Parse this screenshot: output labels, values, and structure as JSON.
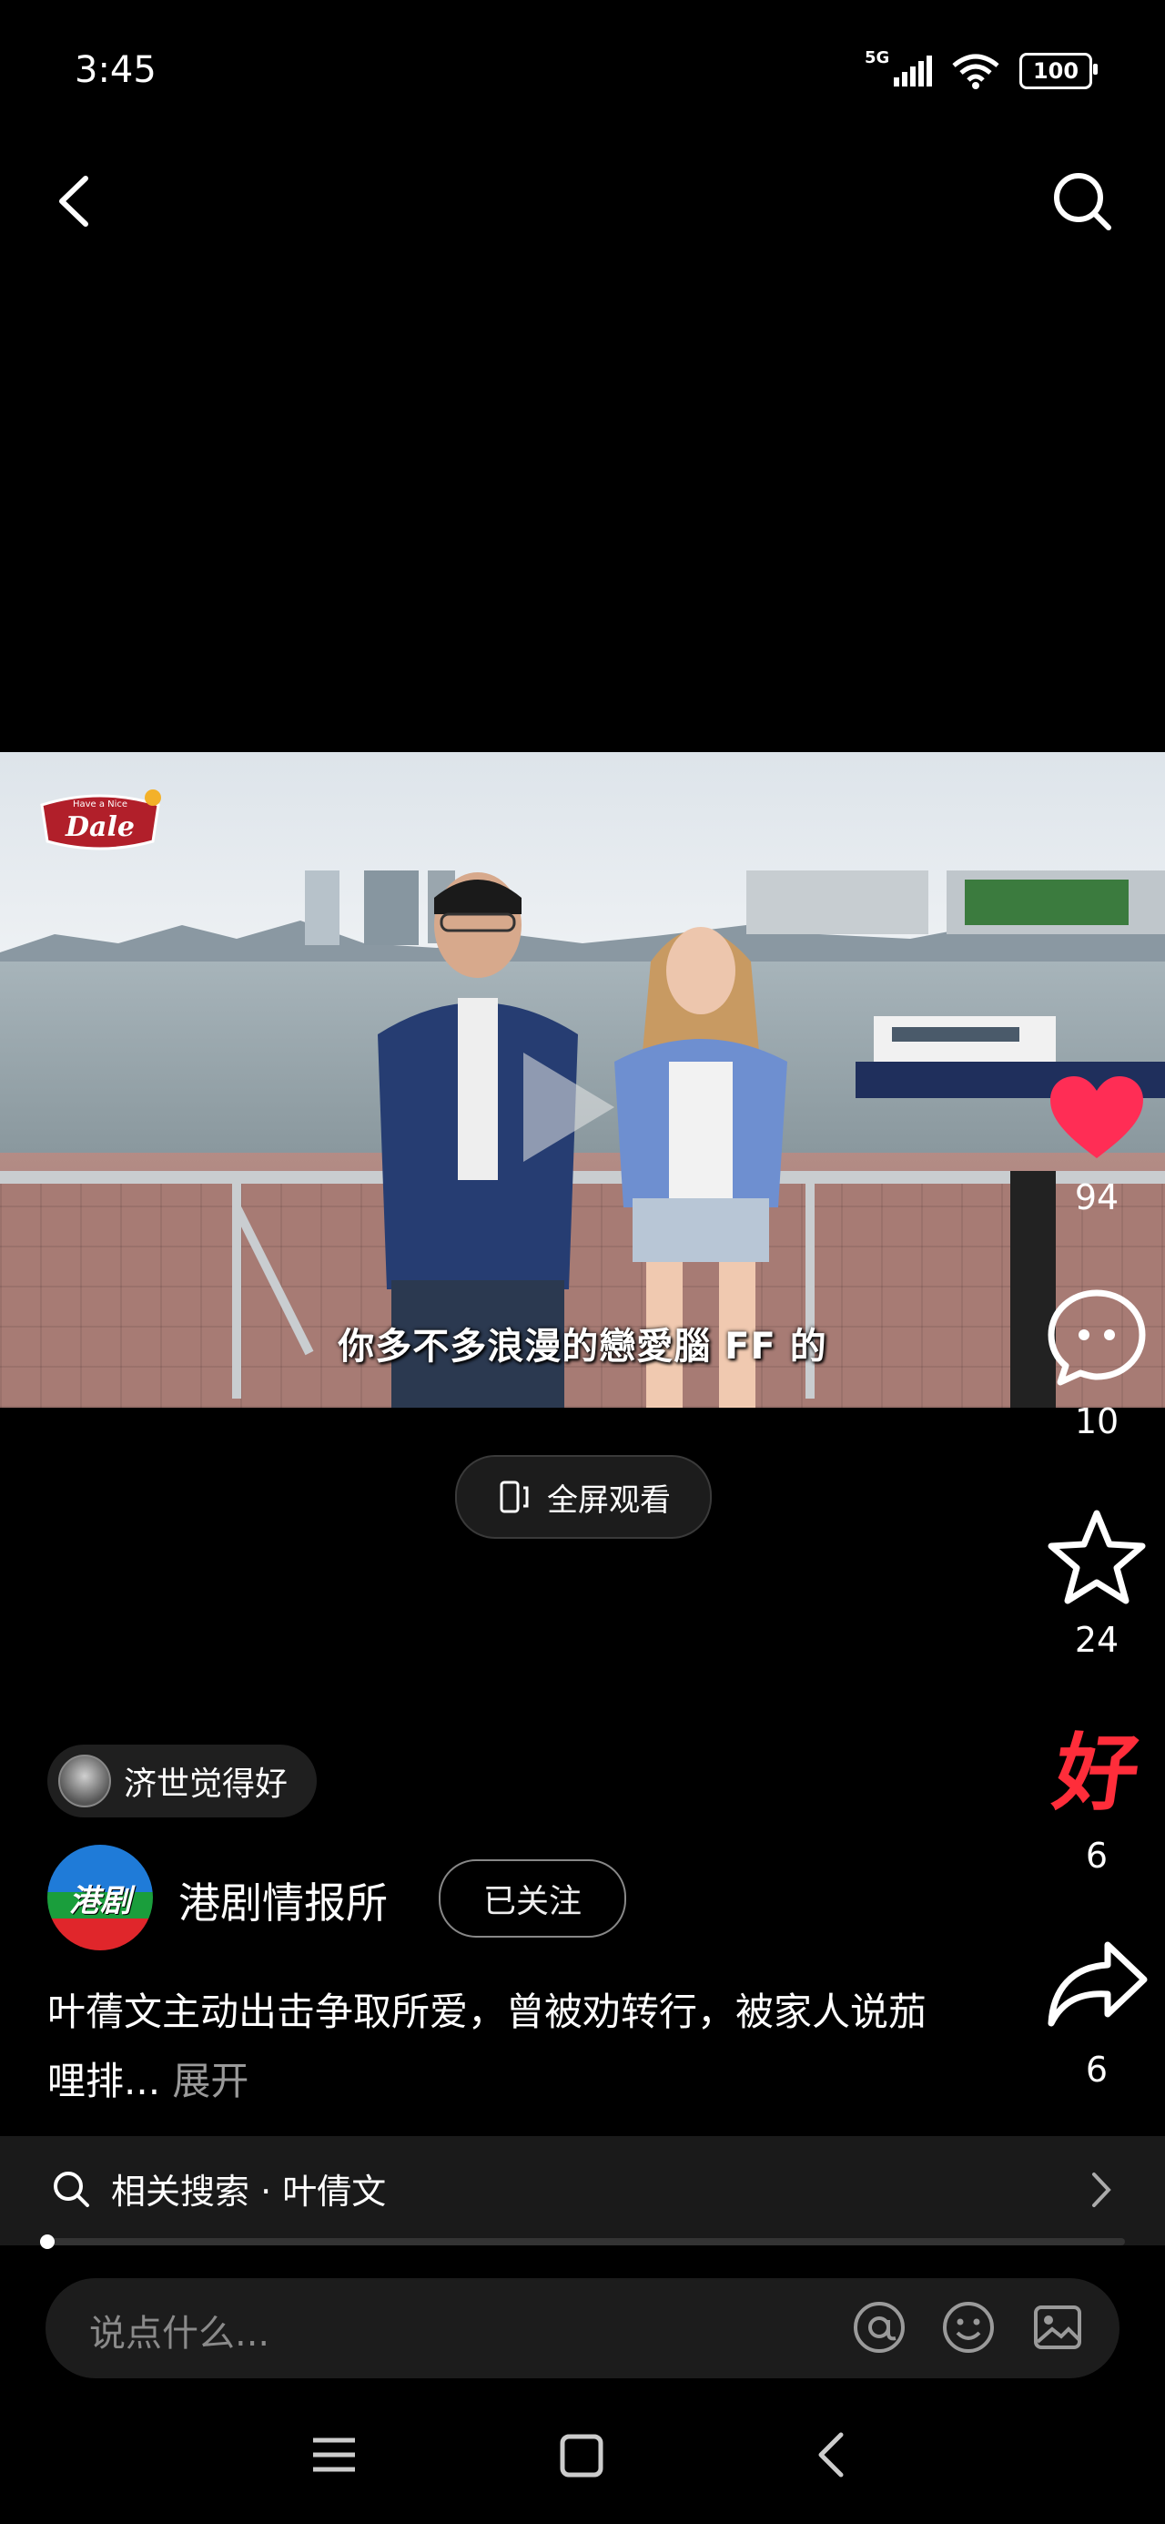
{
  "status_bar": {
    "time": "3:45",
    "network": "5G",
    "battery": "100"
  },
  "video": {
    "subtitle": "你多不多浪漫的戀愛腦 FF 的",
    "logo_top": "Have a Nice",
    "logo_main": "Dale"
  },
  "fullscreen": {
    "label": "全屏观看"
  },
  "actions": {
    "like_count": "94",
    "comment_count": "10",
    "favorite_count": "24",
    "good_label": "好",
    "good_count": "6",
    "share_count": "6"
  },
  "tag_chip": {
    "label": "济世觉得好"
  },
  "author": {
    "avatar_text": "港剧",
    "name": "港剧情报所",
    "follow_label": "已关注"
  },
  "description": {
    "text": "叶蒨文主动出击争取所爱，曾被劝转行，被家人说茄哩排...",
    "expand_label": "展开"
  },
  "related_search": {
    "label": "相关搜索 · 叶倩文"
  },
  "playback": {
    "progress_fraction": 0.01
  },
  "comment_input": {
    "placeholder": "说点什么..."
  },
  "colors": {
    "like": "#ff2d55",
    "good": "#ff2d3a",
    "background": "#000000"
  }
}
